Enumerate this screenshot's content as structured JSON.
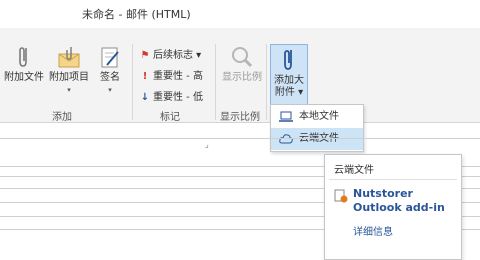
{
  "window": {
    "title": "未命名 - 邮件 (HTML)"
  },
  "ribbon": {
    "attach_file": "附加文件",
    "attach_item": "附加项目",
    "signature": "签名",
    "group_add": "添加",
    "followup": "后续标志 ▾",
    "importance_high": "重要性 - 高",
    "importance_low": "重要性 - 低",
    "group_tags": "标记",
    "show_zoom": "显示比例",
    "group_zoom": "显示比例",
    "add_big_attach_line1": "添加大",
    "add_big_attach_line2": "附件 ▾"
  },
  "dropdown": {
    "items": [
      {
        "label": "本地文件",
        "icon": "laptop-icon"
      },
      {
        "label": "云端文件",
        "icon": "cloud-icon"
      }
    ]
  },
  "tooltip": {
    "title": "云端文件",
    "addin_name": "Nutstorer Outlook add-in",
    "more_info": "详细信息"
  },
  "colors": {
    "accent": "#2a5699",
    "highlight": "#cde4f7",
    "ribbon_bg": "#f3f3f3"
  }
}
